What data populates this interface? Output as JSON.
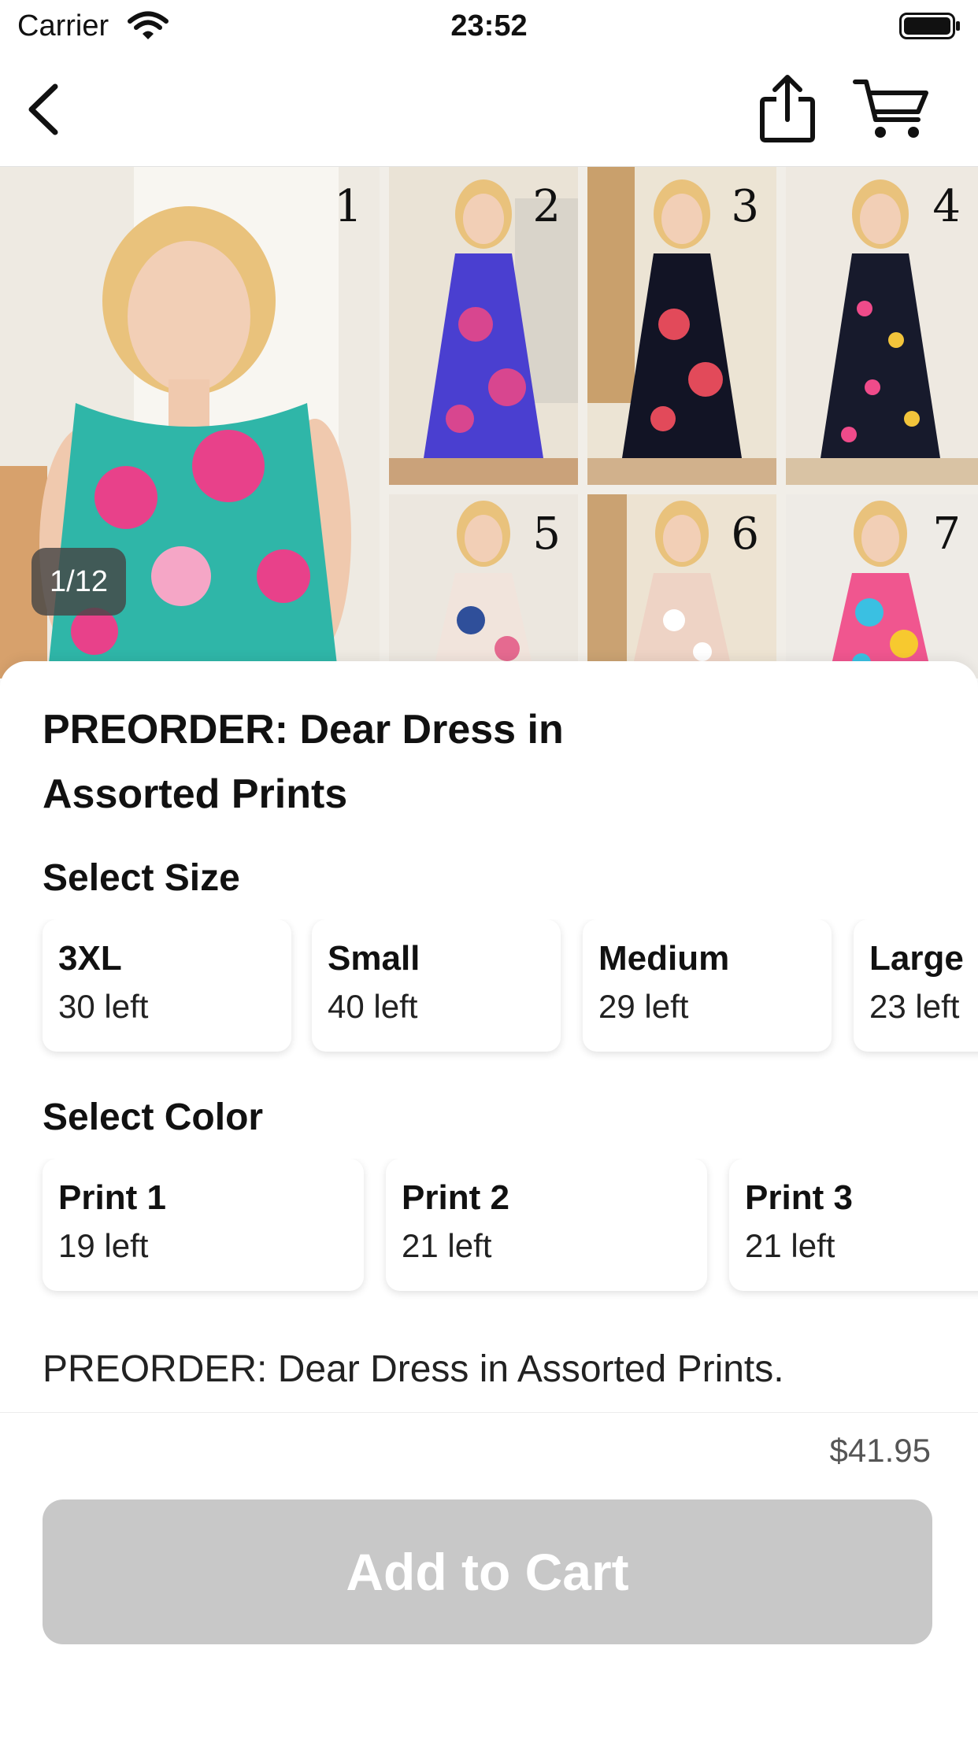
{
  "status_bar": {
    "carrier": "Carrier",
    "time": "23:52"
  },
  "nav": {
    "back_icon": "chevron-left-icon",
    "share_icon": "share-icon",
    "cart_icon": "cart-icon"
  },
  "gallery": {
    "page_indicator": "1/12",
    "photos": [
      {
        "number": "1",
        "dress_colors": [
          "#2fb6a8",
          "#e8418a",
          "#f5a6c6"
        ]
      },
      {
        "number": "2",
        "dress_colors": [
          "#4a3fd0",
          "#d8468f",
          "#7ad0ef"
        ]
      },
      {
        "number": "3",
        "dress_colors": [
          "#121425",
          "#e24a5a",
          "#2bb6c9"
        ]
      },
      {
        "number": "4",
        "dress_colors": [
          "#171a2c",
          "#ef4b8a",
          "#f2c43b"
        ]
      },
      {
        "number": "5",
        "dress_colors": [
          "#f1e4dc",
          "#2f4f9a",
          "#e56a90"
        ]
      },
      {
        "number": "6",
        "dress_colors": [
          "#eed3c5",
          "#ffffff",
          "#e5bfae"
        ]
      },
      {
        "number": "7",
        "dress_colors": [
          "#f0568f",
          "#3ac0e2",
          "#f7c92f"
        ]
      }
    ]
  },
  "product": {
    "title": "PREORDER: Dear Dress in Assorted Prints",
    "description": "PREORDER: Dear Dress in Assorted Prints."
  },
  "size": {
    "label": "Select Size",
    "options": [
      {
        "name": "3XL",
        "stock": "30 left"
      },
      {
        "name": "Small",
        "stock": "40 left"
      },
      {
        "name": "Medium",
        "stock": "29 left"
      },
      {
        "name": "Large",
        "stock": "23 left"
      }
    ]
  },
  "color": {
    "label": "Select Color",
    "options": [
      {
        "name": "Print 1",
        "stock": "19 left"
      },
      {
        "name": "Print 2",
        "stock": "21 left"
      },
      {
        "name": "Print 3",
        "stock": "21 left"
      }
    ]
  },
  "footer": {
    "price": "$41.95",
    "add_to_cart": "Add to Cart"
  },
  "colors": {
    "button_disabled": "#c8c8c8",
    "text": "#111111",
    "price": "#555555"
  }
}
